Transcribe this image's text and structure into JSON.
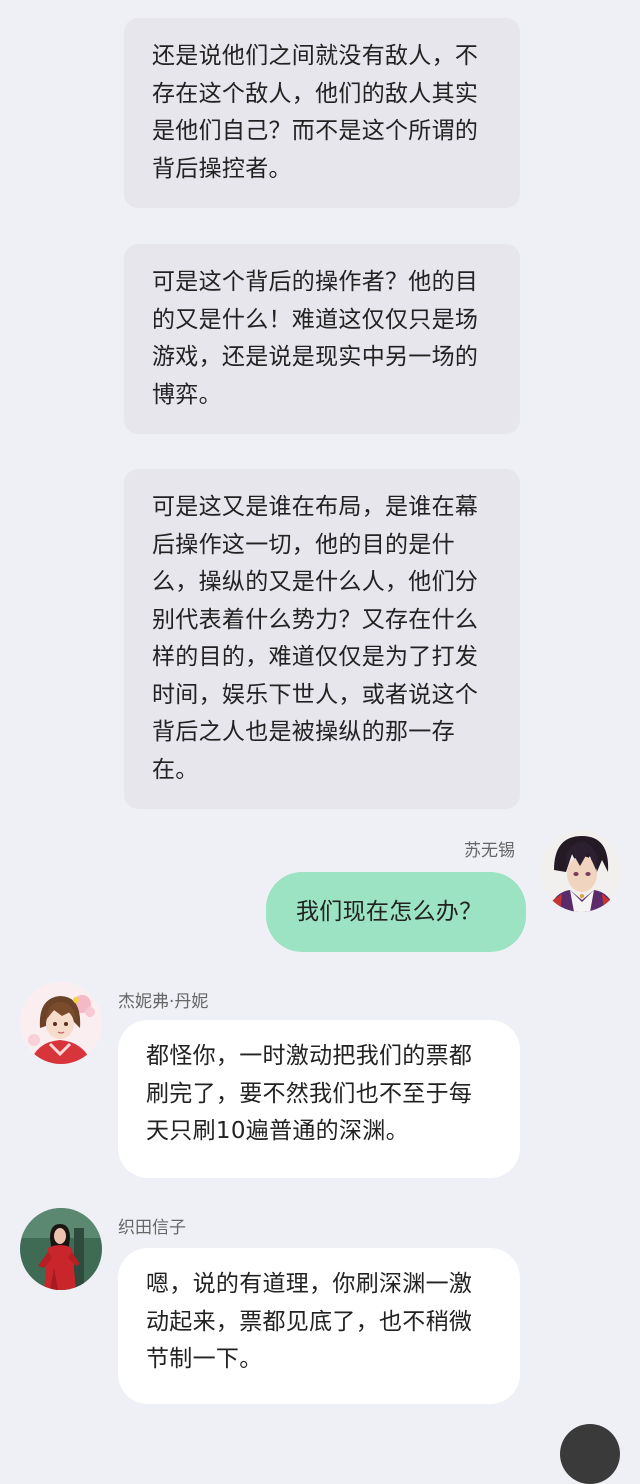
{
  "messages": [
    {
      "type": "incoming-gray",
      "text": "还是说他们之间就没有敌人，不存在这个敌人，他们的敌人其实是他们自己？而不是这个所谓的背后操控者。"
    },
    {
      "type": "incoming-gray",
      "text": "可是这个背后的操作者？他的目的又是什么！难道这仅仅只是场游戏，还是说是现实中另一场的博弈。"
    },
    {
      "type": "incoming-gray",
      "text": "可是这又是谁在布局，是谁在幕后操作这一切，他的目的是什么，操纵的又是什么人，他们分别代表着什么势力？又存在什么样的目的，难道仅仅是为了打发时间，娱乐下世人，或者说这个背后之人也是被操纵的那一存在。"
    },
    {
      "type": "outgoing",
      "sender": "苏无锡",
      "text": "我们现在怎么办？",
      "avatar_icon": "anime-boy-avatar"
    },
    {
      "type": "incoming",
      "sender": "杰妮弗·丹妮",
      "text": "都怪你，一时激动把我们的票都刷完了，要不然我们也不至于每天只刷10遍普通的深渊。",
      "avatar_icon": "anime-girl-avatar"
    },
    {
      "type": "incoming",
      "sender": "织田信子",
      "text": "嗯，说的有道理，你刷深渊一激动起来，票都见底了，也不稍微节制一下。",
      "avatar_icon": "woman-red-dress-avatar"
    }
  ],
  "colors": {
    "background": "#eff0f5",
    "gray_bubble": "#e6e6ec",
    "outgoing_bubble": "#9be3c3",
    "incoming_bubble": "#ffffff"
  }
}
